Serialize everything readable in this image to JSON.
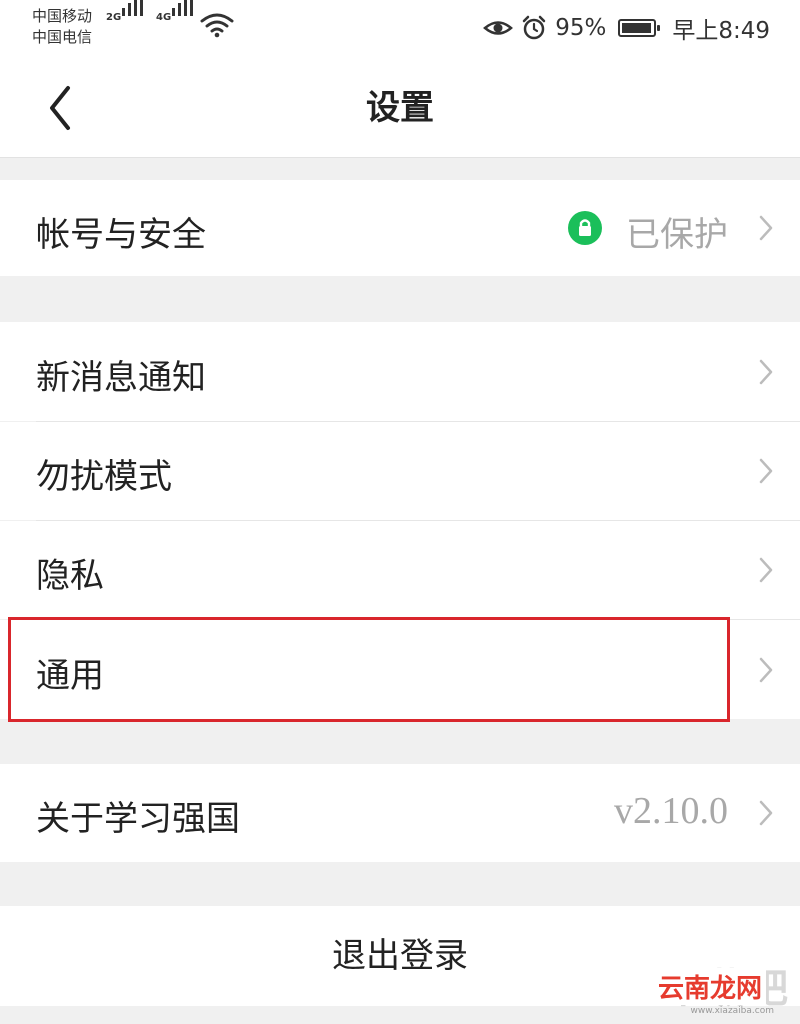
{
  "status_bar": {
    "carrier_1": "中国移动",
    "carrier_2": "中国电信",
    "network_1": "2G",
    "network_2": "4G",
    "battery_percent": "95%",
    "battery_level": 0.95,
    "time": "早上8:49",
    "icons": [
      "signal-icon",
      "wifi-icon",
      "eye-icon",
      "alarm-icon",
      "battery-icon"
    ]
  },
  "nav": {
    "title": "设置",
    "back_icon": "chevron-left-icon"
  },
  "sections": {
    "account": {
      "label": "帐号与安全",
      "value": "已保护",
      "icon": "lock-icon"
    },
    "notifications": {
      "label": "新消息通知"
    },
    "dnd": {
      "label": "勿扰模式"
    },
    "privacy": {
      "label": "隐私"
    },
    "general": {
      "label": "通用"
    },
    "about": {
      "label": "关于学习强国",
      "value": "v2.10.0"
    }
  },
  "logout": {
    "label": "退出登录"
  },
  "watermark": {
    "top": "下载吧",
    "main": "云南龙网",
    "sub": "www.xiazaiba.com"
  },
  "colors": {
    "accent_green": "#1bbf5a",
    "highlight_red": "#d9262c",
    "background": "#f0f0f0",
    "secondary_text": "#a8a8a8"
  }
}
